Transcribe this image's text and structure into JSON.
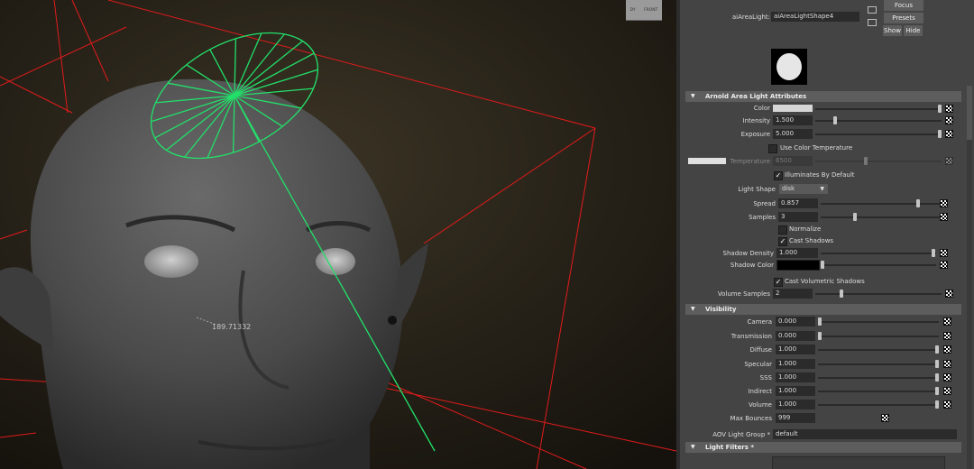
{
  "viewport": {
    "measure_value": "189.71332",
    "viewcube_left": "DY",
    "viewcube_right": "FRONT"
  },
  "header": {
    "node_label": "aiAreaLight:",
    "node_value": "aiAreaLightShape4",
    "focus_label": "Focus",
    "presets_label": "Presets",
    "show_label": "Show",
    "hide_label": "Hide"
  },
  "sections": {
    "arnold": "Arnold Area Light Attributes",
    "visibility": "Visibility",
    "light_filters": "Light Filters *"
  },
  "arnold": {
    "color_label": "Color",
    "color_hex": "#d6d6d6",
    "intensity_label": "Intensity",
    "intensity_value": "1.500",
    "exposure_label": "Exposure",
    "exposure_value": "5.000",
    "use_color_temp_label": "Use Color Temperature",
    "temperature_label": "Temperature",
    "temperature_value": "6500",
    "illuminates_label": "Illuminates By Default",
    "light_shape_label": "Light Shape",
    "light_shape_value": "disk",
    "spread_label": "Spread",
    "spread_value": "0.857",
    "samples_label": "Samples",
    "samples_value": "3",
    "normalize_label": "Normalize",
    "cast_shadows_label": "Cast Shadows",
    "shadow_density_label": "Shadow Density",
    "shadow_density_value": "1.000",
    "shadow_color_label": "Shadow Color",
    "shadow_color_hex": "#000000",
    "cast_vol_label": "Cast Volumetric Shadows",
    "volume_samples_label": "Volume Samples",
    "volume_samples_value": "2",
    "check_mark": "✓"
  },
  "visibility": {
    "camera_label": "Camera",
    "camera_value": "0.000",
    "transmission_label": "Transmission",
    "transmission_value": "0.000",
    "diffuse_label": "Diffuse",
    "diffuse_value": "1.000",
    "specular_label": "Specular",
    "specular_value": "1.000",
    "sss_label": "SSS",
    "sss_value": "1.000",
    "indirect_label": "Indirect",
    "indirect_value": "1.000",
    "volume_label": "Volume",
    "volume_value": "1.000",
    "max_bounces_label": "Max Bounces",
    "max_bounces_value": "999",
    "aov_label": "AOV Light Group *",
    "aov_value": "default"
  },
  "icons": {
    "collapse": "▼"
  },
  "colors": {
    "light_gizmo": "#22e06a",
    "camera_frustum": "#e11b1b",
    "panel_bg": "#444444"
  }
}
